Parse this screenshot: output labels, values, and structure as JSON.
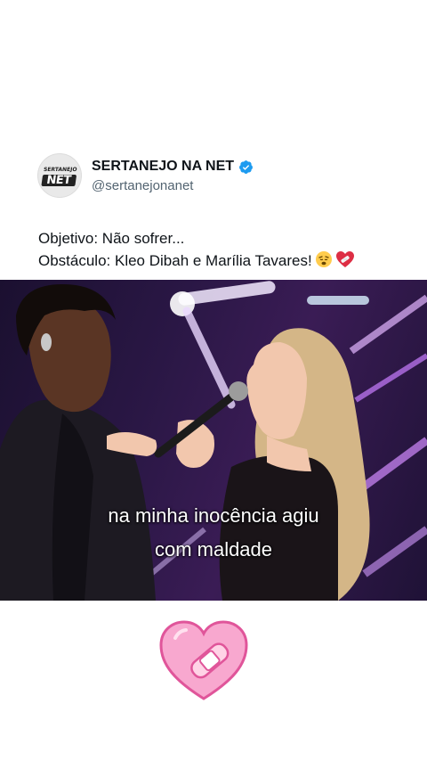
{
  "post": {
    "author_name": "SERTANEJO NA NET",
    "author_handle": "@sertanejonanet",
    "avatar_text_top": "SERTANEJO",
    "avatar_text_bottom": "NET",
    "verified": true,
    "text_line1": "Objetivo: Não sofrer...",
    "text_line2": "Obstáculo: Kleo Dibah e Marília Tavares!"
  },
  "video": {
    "caption_line1": "na minha inocência agiu",
    "caption_line2": "com maldade"
  },
  "icons": {
    "verified": "verified-badge-icon",
    "emoji1": "tired-face-emoji",
    "emoji2": "mending-heart-emoji",
    "sticker": "bandaged-heart-sticker"
  },
  "colors": {
    "verified": "#1d9bf0",
    "text": "#0f1419",
    "handle": "#536471",
    "heart": "#f48bc4"
  }
}
